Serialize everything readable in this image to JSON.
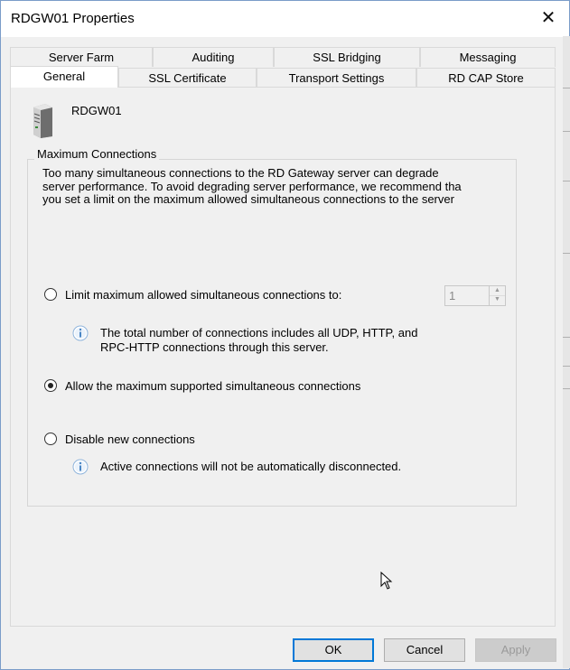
{
  "window": {
    "title": "RDGW01 Properties",
    "close_glyph": "✕"
  },
  "tabs_back": [
    {
      "label": "Server Farm"
    },
    {
      "label": "Auditing"
    },
    {
      "label": "SSL Bridging"
    },
    {
      "label": "Messaging"
    }
  ],
  "tabs_front": [
    {
      "label": "General",
      "active": true
    },
    {
      "label": "SSL Certificate"
    },
    {
      "label": "Transport Settings"
    },
    {
      "label": "RD CAP Store"
    }
  ],
  "server": {
    "name": "RDGW01",
    "icon": "server-icon"
  },
  "max_connections": {
    "legend": "Maximum Connections",
    "description": "Too many simultaneous connections to the RD Gateway server can degrade\nserver performance. To avoid degrading server performance, we recommend tha\nyou set a limit on the maximum allowed simultaneous connections to the server",
    "option_limit": {
      "label": "Limit maximum allowed simultaneous connections to:",
      "checked": false,
      "value": "1",
      "info": "The total number of connections includes all UDP, HTTP, and\nRPC-HTTP connections through this server."
    },
    "option_allow_max": {
      "label": "Allow the maximum supported simultaneous connections",
      "checked": true
    },
    "option_disable": {
      "label": "Disable new connections",
      "checked": false,
      "info": "Active connections will not be automatically disconnected."
    }
  },
  "buttons": {
    "ok": "OK",
    "cancel": "Cancel",
    "apply": "Apply"
  },
  "colors": {
    "accent": "#0078d7",
    "info_icon": "#4a86c5"
  }
}
